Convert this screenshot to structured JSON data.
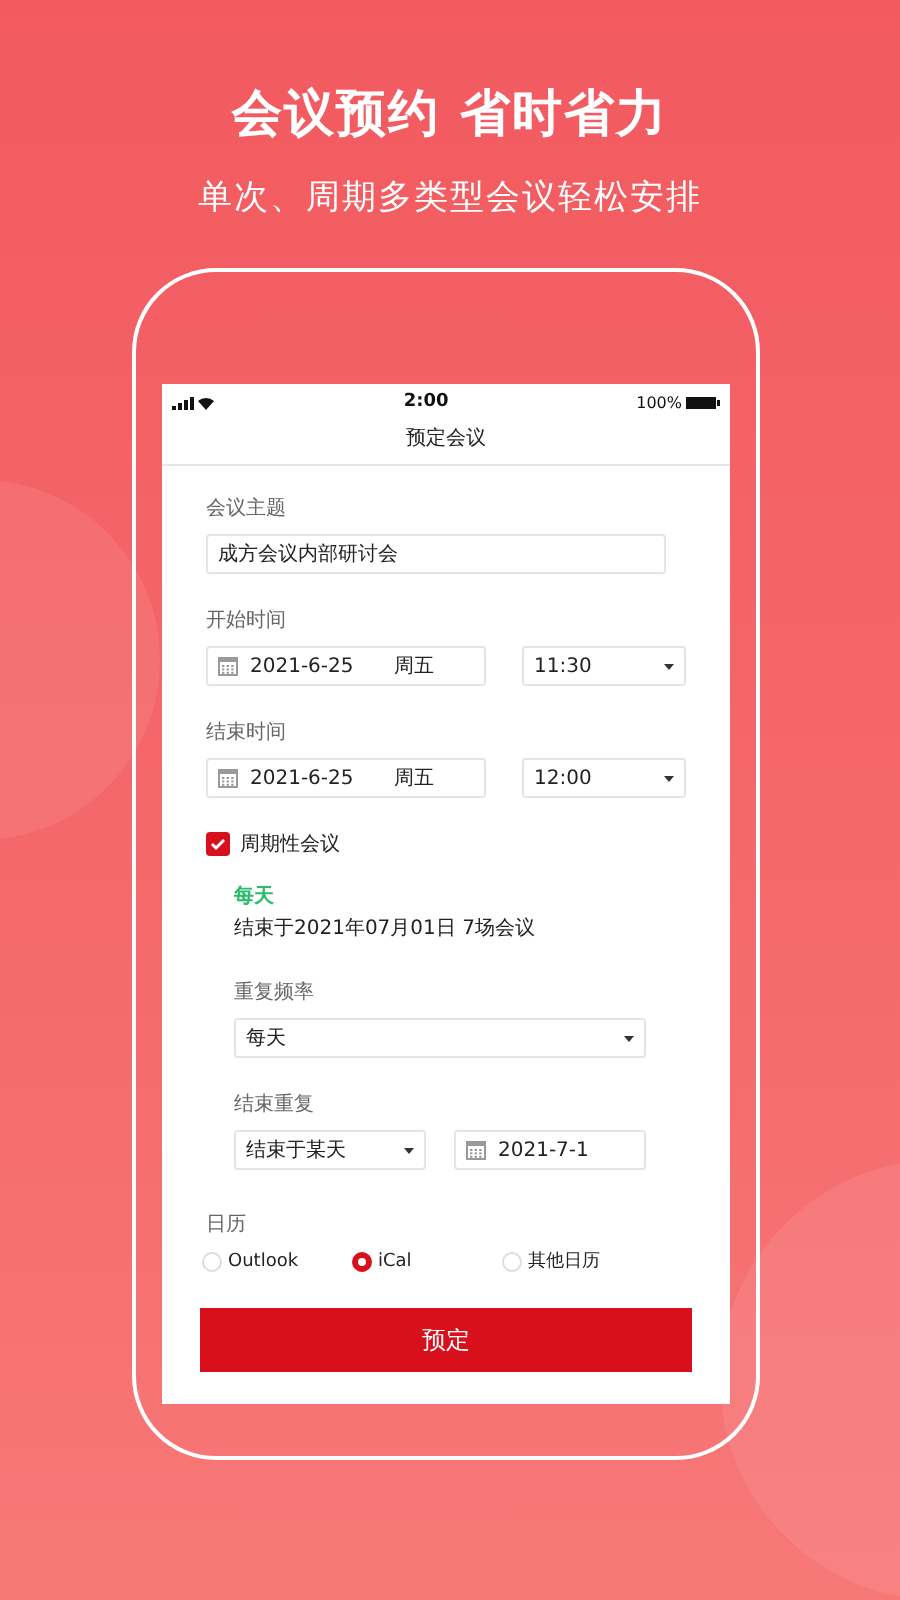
{
  "headline": "会议预约 省时省力",
  "subheadline": "单次、周期多类型会议轻松安排",
  "status_bar": {
    "time": "2:00",
    "battery": "100%"
  },
  "screen_title": "预定会议",
  "subject": {
    "label": "会议主题",
    "value": "成方会议内部研讨会"
  },
  "start": {
    "label": "开始时间",
    "date": "2021-6-25",
    "weekday": "周五",
    "time": "11:30"
  },
  "end": {
    "label": "结束时间",
    "date": "2021-6-25",
    "weekday": "周五",
    "time": "12:00"
  },
  "recurring": {
    "label": "周期性会议",
    "checked": true,
    "summary_title": "每天",
    "summary": "结束于2021年07月01日 7场会议",
    "frequency": {
      "label": "重复频率",
      "value": "每天"
    },
    "end_repeat": {
      "label": "结束重复",
      "mode": "结束于某天",
      "date": "2021-7-1"
    }
  },
  "calendar": {
    "label": "日历",
    "options": [
      {
        "label": "Outlook",
        "selected": false
      },
      {
        "label": "iCal",
        "selected": true
      },
      {
        "label": "其他日历",
        "selected": false
      }
    ]
  },
  "submit": "预定"
}
